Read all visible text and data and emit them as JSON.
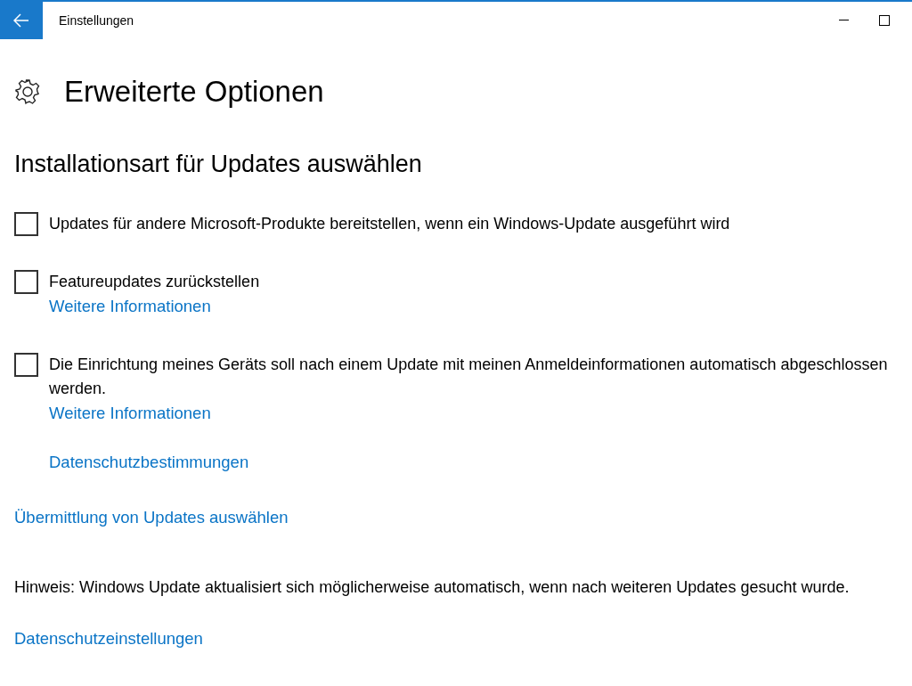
{
  "window": {
    "title": "Einstellungen"
  },
  "page": {
    "title": "Erweiterte Optionen"
  },
  "section": {
    "heading": "Installationsart für Updates auswählen",
    "options": [
      {
        "label": "Updates für andere Microsoft-Produkte bereitstellen, wenn ein Windows-Update ausgeführt wird",
        "checked": false
      },
      {
        "label": "Featureupdates zurückstellen",
        "checked": false,
        "link": "Weitere Informationen"
      },
      {
        "label": "Die Einrichtung meines Geräts soll nach einem Update mit meinen Anmeldeinformationen automatisch abgeschlossen werden.",
        "checked": false,
        "link": "Weitere Informationen"
      }
    ],
    "privacy_link": "Datenschutzbestimmungen"
  },
  "delivery_link": "Übermittlung von Updates auswählen",
  "note": "Hinweis: Windows Update aktualisiert sich möglicherweise automatisch, wenn nach weiteren Updates gesucht wurde.",
  "settings_link": "Datenschutzeinstellungen"
}
